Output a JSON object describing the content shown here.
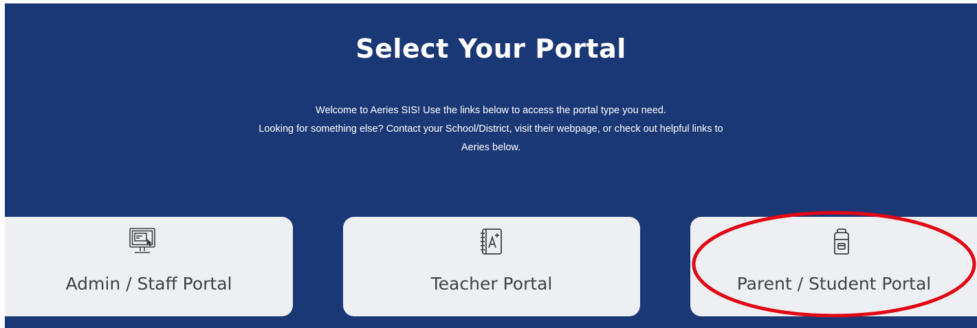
{
  "header": {
    "title": "Select Your Portal"
  },
  "intro": {
    "line1": "Welcome to Aeries SIS! Use the links below to access the portal type you need.",
    "line2": "Looking for something else? Contact your School/District, visit their webpage, or check out helpful links to",
    "line3": "Aeries below."
  },
  "portals": [
    {
      "label": "Admin / Staff Portal",
      "icon": "computer-monitor-icon"
    },
    {
      "label": "Teacher Portal",
      "icon": "gradebook-icon"
    },
    {
      "label": "Parent / Student Portal",
      "icon": "backpack-icon"
    }
  ],
  "colors": {
    "background": "#1b3876",
    "card": "#eeeff2",
    "card_text": "#3d4147",
    "highlight": "#e30613"
  }
}
